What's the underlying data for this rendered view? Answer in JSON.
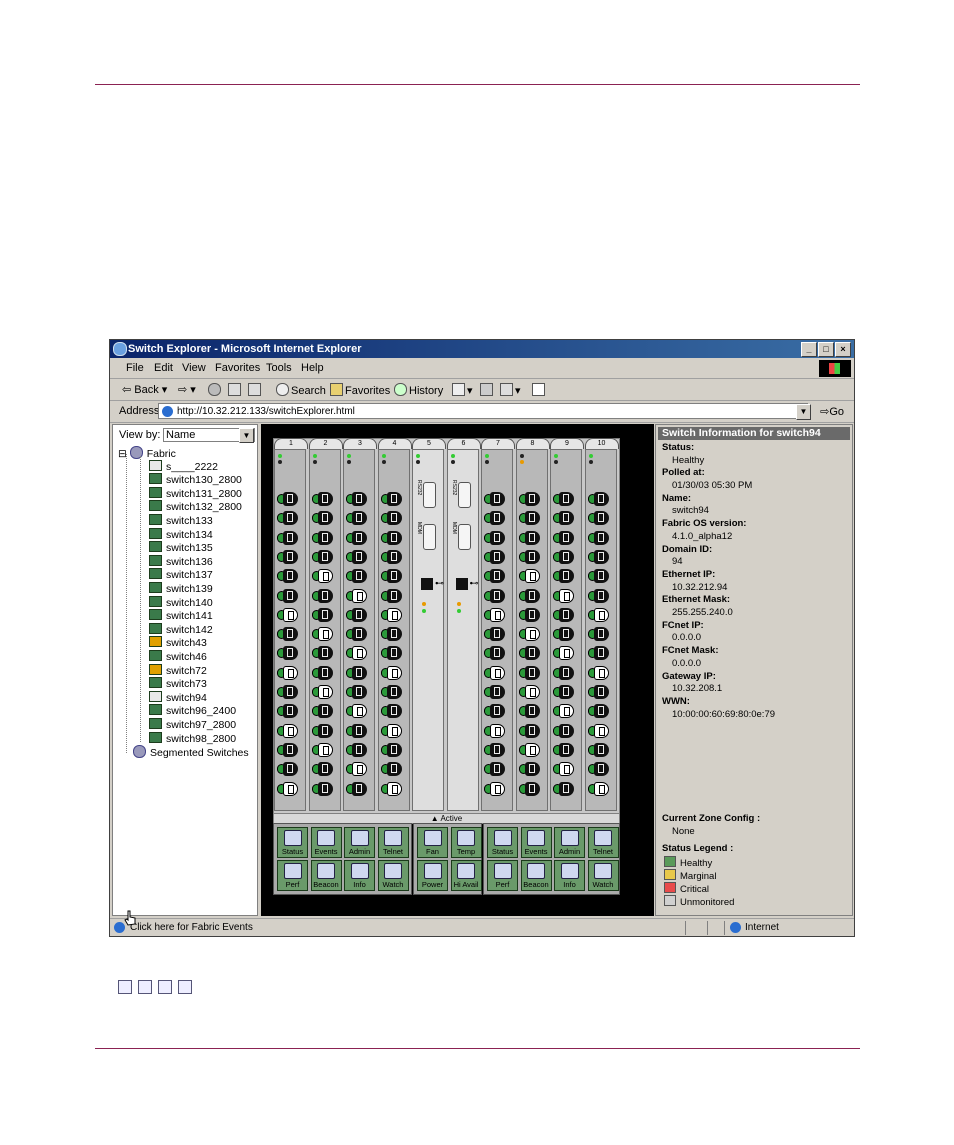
{
  "window": {
    "title": "Switch Explorer - Microsoft Internet Explorer",
    "minimize": "_",
    "maximize": "□",
    "close": "×"
  },
  "menu": [
    "File",
    "Edit",
    "View",
    "Favorites",
    "Tools",
    "Help"
  ],
  "toolbar": {
    "back": "Back",
    "search": "Search",
    "favorites": "Favorites",
    "history": "History"
  },
  "address": {
    "label": "Address",
    "url": "http://10.32.212.133/switchExplorer.html",
    "go": "Go"
  },
  "left_panel": {
    "view_by_label": "View by:",
    "view_by_value": "Name",
    "tree": {
      "root": "Fabric",
      "switches": [
        {
          "name": "s____2222",
          "status": "w"
        },
        {
          "name": "switch130_2800",
          "status": "g"
        },
        {
          "name": "switch131_2800",
          "status": "g"
        },
        {
          "name": "switch132_2800",
          "status": "g"
        },
        {
          "name": "switch133",
          "status": "g"
        },
        {
          "name": "switch134",
          "status": "g"
        },
        {
          "name": "switch135",
          "status": "g"
        },
        {
          "name": "switch136",
          "status": "g"
        },
        {
          "name": "switch137",
          "status": "g"
        },
        {
          "name": "switch139",
          "status": "g"
        },
        {
          "name": "switch140",
          "status": "g"
        },
        {
          "name": "switch141",
          "status": "g"
        },
        {
          "name": "switch142",
          "status": "g"
        },
        {
          "name": "switch43",
          "status": "y"
        },
        {
          "name": "switch46",
          "status": "g"
        },
        {
          "name": "switch72",
          "status": "y"
        },
        {
          "name": "switch73",
          "status": "g"
        },
        {
          "name": "switch94",
          "status": "w"
        },
        {
          "name": "switch96_2400",
          "status": "g"
        },
        {
          "name": "switch97_2800",
          "status": "g"
        },
        {
          "name": "switch98_2800",
          "status": "g"
        }
      ],
      "segmented": "Segmented Switches"
    }
  },
  "center": {
    "slots": [
      "1",
      "2",
      "3",
      "4",
      "5",
      "6",
      "7",
      "8",
      "9",
      "10"
    ],
    "cp_labels": {
      "rs": "RS232",
      "modem": "MDM"
    },
    "active_label": "▲ Active",
    "controls_left": [
      "Status",
      "Events",
      "Admin",
      "Telnet",
      "Perf",
      "Beacon",
      "Info",
      "Watch"
    ],
    "controls_mid": [
      "Fan",
      "Temp",
      "Power",
      "Hi Avail"
    ],
    "controls_right": [
      "Status",
      "Events",
      "Admin",
      "Telnet",
      "Perf",
      "Beacon",
      "Info",
      "Watch"
    ]
  },
  "right_panel": {
    "header": "Switch Information for switch94",
    "fields": [
      {
        "label": "Status:",
        "value": "Healthy"
      },
      {
        "label": "Polled at:",
        "value": "01/30/03 05:30 PM"
      },
      {
        "label": "Name:",
        "value": "switch94"
      },
      {
        "label": "Fabric OS version:",
        "value": "4.1.0_alpha12"
      },
      {
        "label": "Domain ID:",
        "value": "94"
      },
      {
        "label": "Ethernet IP:",
        "value": "10.32.212.94"
      },
      {
        "label": "Ethernet Mask:",
        "value": "255.255.240.0"
      },
      {
        "label": "FCnet IP:",
        "value": "0.0.0.0"
      },
      {
        "label": "FCnet Mask:",
        "value": "0.0.0.0"
      },
      {
        "label": "Gateway IP:",
        "value": "10.32.208.1"
      },
      {
        "label": "WWN:",
        "value": "10:00:00:60:69:80:0e:79"
      }
    ],
    "zone_label": "Current Zone Config :",
    "zone_value": "None",
    "legend_label": "Status Legend :",
    "legend": [
      {
        "name": "Healthy",
        "color": "#5a9a5a"
      },
      {
        "name": "Marginal",
        "color": "#e8c84a"
      },
      {
        "name": "Critical",
        "color": "#e84a4a"
      },
      {
        "name": "Unmonitored",
        "color": "#d0d0d0"
      }
    ]
  },
  "status_bar": {
    "text": "Click here for Fabric Events",
    "zone": "Internet"
  }
}
